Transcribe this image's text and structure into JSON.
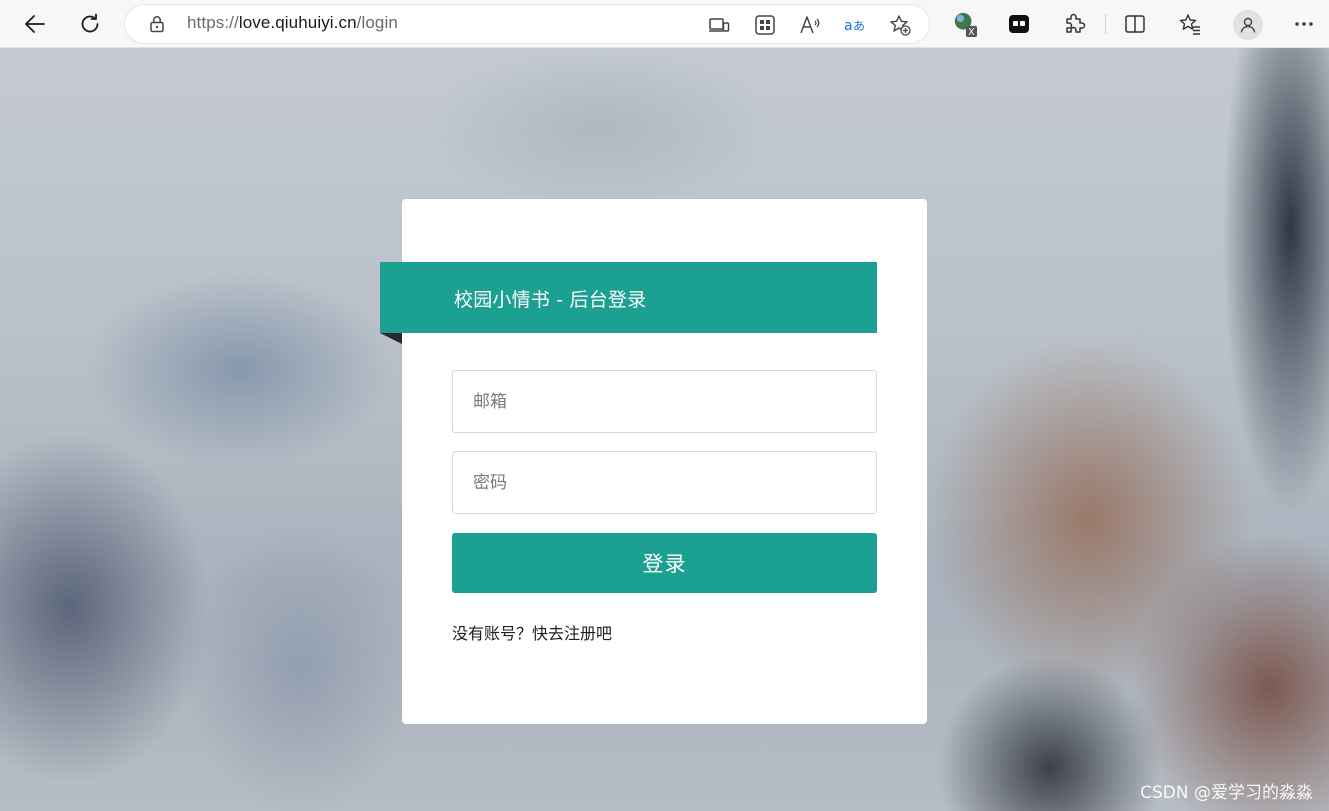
{
  "browser": {
    "url_scheme": "https://",
    "url_host": "love.qiuhuiyi.cn",
    "url_path": "/login",
    "icons": {
      "back": "back-arrow-icon",
      "reload": "reload-icon",
      "lock": "lock-icon",
      "app_available": "app-available-icon",
      "qr": "qr-code-icon",
      "read_aloud": "read-aloud-icon",
      "translate": "translate-icon",
      "add_favorite": "add-favorite-icon",
      "extension_x": "extension-x-icon",
      "tab_ext": "tab-extension-icon",
      "extensions": "puzzle-icon",
      "split_screen": "split-screen-icon",
      "favorites": "favorites-icon",
      "profile": "profile-icon",
      "more": "more-icon"
    },
    "ext_badge": "X"
  },
  "login": {
    "banner_title": "校园小情书 - 后台登录",
    "email_placeholder": "邮箱",
    "password_placeholder": "密码",
    "submit_label": "登录",
    "register_link": "没有账号？快去注册吧",
    "accent_color": "#1ba092"
  },
  "watermark": "CSDN @爱学习的淼淼"
}
